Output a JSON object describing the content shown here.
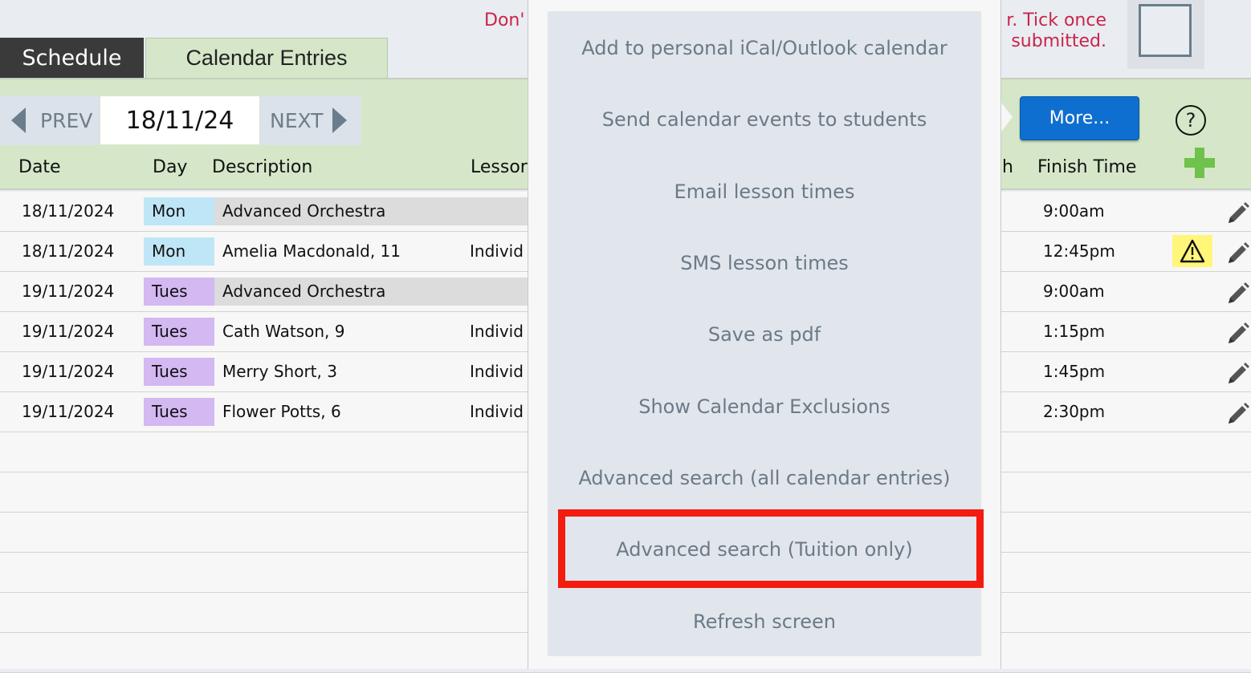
{
  "header": {
    "warning_left": "Don'",
    "warning_right_line1": "r. Tick once",
    "warning_right_line2": "submitted."
  },
  "tabs": [
    {
      "label": "Schedule",
      "active": false
    },
    {
      "label": "Calendar Entries",
      "active": true
    }
  ],
  "toolbar": {
    "prev_label": "PREV",
    "next_label": "NEXT",
    "date_value": "18/11/24",
    "more_label": "More...",
    "help_glyph": "?"
  },
  "columns": {
    "date": "Date",
    "day": "Day",
    "description": "Description",
    "lesson": "Lessor",
    "finish_prefix": "h",
    "finish": "Finish Time"
  },
  "colors": {
    "mon": "#bfe6f7",
    "tues": "#d3b8f2",
    "group": "#dcdcdc",
    "highlight": "#f41b0f",
    "more_button": "#0f6fd0"
  },
  "rows": [
    {
      "date": "18/11/2024",
      "day": "Mon",
      "description": "Advanced Orchestra",
      "lesson": "",
      "finish": "9:00am",
      "group": true,
      "warning": false
    },
    {
      "date": "18/11/2024",
      "day": "Mon",
      "description": "Amelia Macdonald, 11",
      "lesson": "Individ",
      "finish": "12:45pm",
      "group": false,
      "warning": true
    },
    {
      "date": "19/11/2024",
      "day": "Tues",
      "description": "Advanced Orchestra",
      "lesson": "",
      "finish": "9:00am",
      "group": true,
      "warning": false
    },
    {
      "date": "19/11/2024",
      "day": "Tues",
      "description": "Cath Watson, 9",
      "lesson": "Individ",
      "finish": "1:15pm",
      "group": false,
      "warning": false
    },
    {
      "date": "19/11/2024",
      "day": "Tues",
      "description": "Merry Short, 3",
      "lesson": "Individ",
      "finish": "1:45pm",
      "group": false,
      "warning": false
    },
    {
      "date": "19/11/2024",
      "day": "Tues",
      "description": "Flower Potts, 6",
      "lesson": "Individ",
      "finish": "2:30pm",
      "group": false,
      "warning": false
    }
  ],
  "menu": {
    "items": [
      "Add to personal iCal/Outlook calendar",
      "Send calendar events to students",
      "Email lesson times",
      "SMS lesson times",
      "Save as pdf",
      "Show Calendar Exclusions",
      "Advanced search (all calendar entries)",
      "Advanced search (Tuition only)",
      "Refresh screen"
    ],
    "highlighted_index": 7
  }
}
